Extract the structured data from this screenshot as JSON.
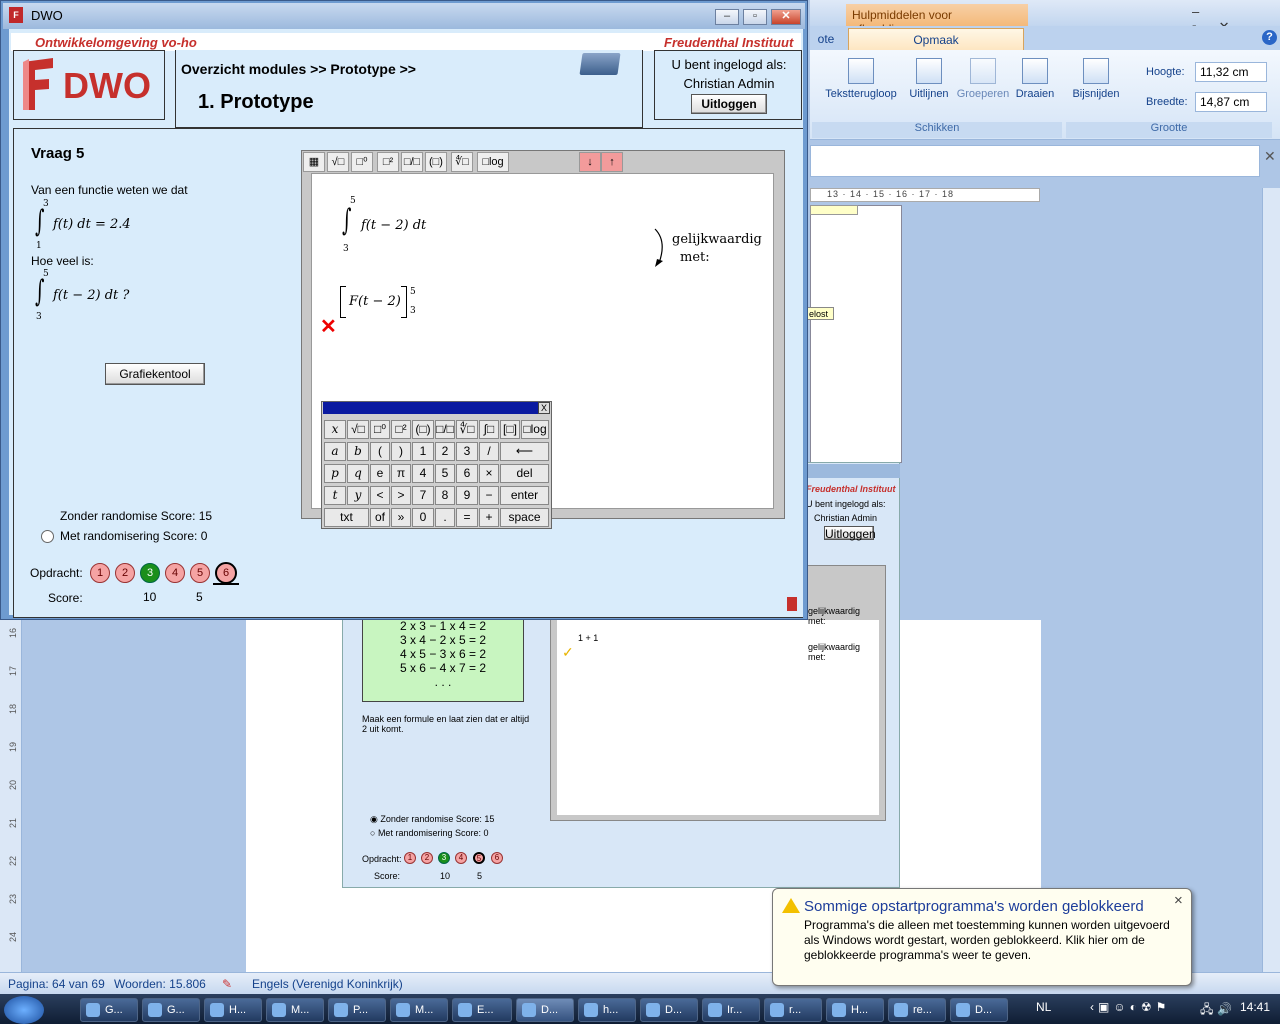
{
  "word": {
    "context_tab": "Hulpmiddelen voor afbeeldingen",
    "tabs": [
      "ote",
      "Opmaak"
    ],
    "ribbon": {
      "buttons": [
        "Tekstterugloop",
        "Uitlijnen",
        "Groeperen",
        "Draaien",
        "Bijsnijden"
      ],
      "groups": [
        "Schikken",
        "Grootte"
      ],
      "height_label": "Hoogte:",
      "height_value": "11,32 cm",
      "width_label": "Breedte:",
      "width_value": "14,87 cm"
    },
    "ruler": "13 · 14 · 15 · 16 · 17 · 18",
    "vruler": [
      "16",
      "17",
      "18",
      "19",
      "20",
      "21",
      "22",
      "23",
      "24"
    ],
    "doc": {
      "lost_label": "elost",
      "emb_header_right": "Freudenthal Instituut",
      "emb_login_label": "U bent ingelogd als:",
      "emb_login_user": "Christian Admin",
      "emb_logout": "Uitloggen",
      "equiv1": "gelijkwaardig met:",
      "equiv2": "gelijkwaardig met:",
      "expr": "1 + 1",
      "formulas": [
        "2 x 3 − 1 x 4 = 2",
        "3 x 4 − 2 x 5 = 2",
        "4 x 5 − 3 x 6 = 2",
        "5 x 6 − 4 x 7 = 2",
        ". . ."
      ],
      "instruction": "Maak een formule en laat zien dat er altijd 2 uit komt.",
      "opt1": "Zonder randomise Score: 15",
      "opt2": "Met randomisering Score: 0",
      "opdracht": "Opdracht:",
      "dots": [
        "1",
        "2",
        "3",
        "4",
        "5",
        "6"
      ],
      "score_label": "Score:",
      "score1": "10",
      "score2": "5"
    },
    "status": {
      "page": "Pagina: 64 van 69",
      "words": "Woorden: 15.806",
      "lang": "Engels (Verenigd Koninkrijk)"
    }
  },
  "dwo": {
    "title": "DWO",
    "header_left": "Ontwikkelomgeving vo-ho",
    "header_right": "Freudenthal Instituut",
    "logo_text": "DWO",
    "breadcrumb": "Overzicht modules >> Prototype >>",
    "page_title": "1.  Prototype",
    "login_label": "U bent ingelogd als:",
    "login_user": "Christian Admin",
    "logout_btn": "Uitloggen",
    "question": {
      "title": "Vraag 5",
      "intro": "Van een functie weten we dat",
      "given": "f(t) dt = 2.4",
      "given_lo": "1",
      "given_hi": "3",
      "ask": "Hoe veel is:",
      "asked": "f(t − 2) dt ?",
      "asked_lo": "3",
      "asked_hi": "5",
      "tool_btn": "Grafiekentool"
    },
    "editor": {
      "toolbar": [
        "▦",
        "√□",
        "□⁰",
        "□²",
        "□/□",
        "(□)",
        "∜□",
        "□log"
      ],
      "arrow_down": "↓",
      "arrow_up": "↑",
      "expr": "f(t − 2) dt",
      "expr_lo": "3",
      "expr_hi": "5",
      "equiv": "gelijkwaardig",
      "met": "met:",
      "answer": "F(t − 2)",
      "answer_lo": "3",
      "answer_hi": "5",
      "wrong_mark": "✕"
    },
    "keypad": {
      "close": "X",
      "rows": [
        [
          "x",
          "√□",
          "□⁰",
          "□²",
          "(□)",
          "□/□",
          "∜□",
          "∫□",
          "[□]",
          "□log"
        ],
        [
          "a",
          "b",
          "(",
          ")",
          "1",
          "2",
          "3",
          "/",
          "⟵"
        ],
        [
          "p",
          "q",
          "e",
          "π",
          "4",
          "5",
          "6",
          "×",
          "del"
        ],
        [
          "t",
          "y",
          "<",
          ">",
          "7",
          "8",
          "9",
          "−",
          "enter"
        ],
        [
          "txt",
          "of",
          "»",
          "0",
          ".",
          "=",
          "+",
          "space"
        ]
      ]
    },
    "options": {
      "opt1": "Zonder randomise Score: 15",
      "opt2": "Met randomisering Score: 0"
    },
    "opdracht_label": "Opdracht:",
    "dots": [
      "1",
      "2",
      "3",
      "4",
      "5",
      "6"
    ],
    "score_label": "Score:",
    "score1": "10",
    "score2": "5"
  },
  "balloon": {
    "title": "Sommige opstartprogramma's worden geblokkeerd",
    "body": "Programma's die alleen met toestemming kunnen worden uitgevoerd als Windows wordt gestart, worden geblokkeerd. Klik hier om de geblokkeerde programma's weer te geven.",
    "close": "×"
  },
  "taskbar": {
    "items": [
      "G...",
      "G...",
      "H...",
      "M...",
      "P...",
      "M...",
      "E...",
      "D...",
      "h...",
      "D...",
      "Ir...",
      "r...",
      "H...",
      "re...",
      "D..."
    ],
    "lang": "NL",
    "clock": "14:41"
  }
}
